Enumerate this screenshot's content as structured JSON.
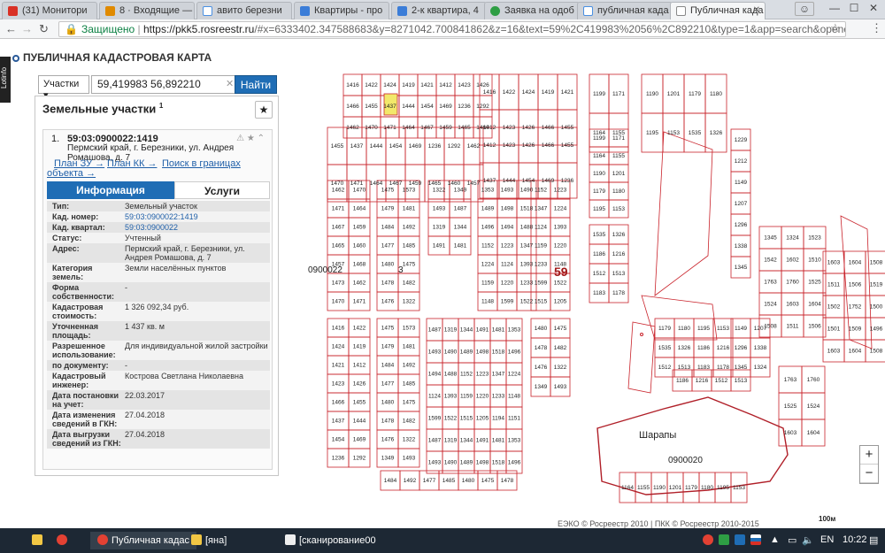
{
  "browser": {
    "tabs": [
      {
        "title": "(31) Монитори",
        "color": "#d93025"
      },
      {
        "title": "8 · Входящие —",
        "color": "#e08a00"
      },
      {
        "title": "авито березни",
        "color": "#4a90e2"
      },
      {
        "title": "Квартиры - про",
        "color": "#3b7dd8"
      },
      {
        "title": "2-к квартира, 4",
        "color": "#3b7dd8"
      },
      {
        "title": "Заявка на одоб",
        "color": "#2e9e44"
      },
      {
        "title": "публичная када",
        "color": "#4a90e2"
      },
      {
        "title": "Публичная када",
        "color": "#e9eaec"
      }
    ],
    "secure_label": "Защищено",
    "url_host": "https://pkk5.rosreestr.ru",
    "url_path": "/#x=6333402.347588683&y=8271042.700841862&z=16&text=59%2C419983%2056%2C892210&type=1&app=search&opened=1"
  },
  "app": {
    "logo_text": "Lotinfo",
    "title": "ПУБЛИЧНАЯ КАДАСТРОВАЯ КАРТА",
    "search": {
      "type_label": "Участки",
      "query": "59,419983 56,892210",
      "find_label": "Найти"
    },
    "panel": {
      "heading": "Земельные участки",
      "count": "1",
      "item_index": "1.",
      "cad_number": "59:03:0900022:1419",
      "address": "Пермский край, г. Березники, ул. Андрея Ромашова, д. 7",
      "links": {
        "plan_zu": "План ЗУ →",
        "plan_kk": "План КК →",
        "search_in": "Поиск в границах",
        "search_in2": "объекта →"
      },
      "tab_info": "Информация",
      "tab_services": "Услуги",
      "attributes": [
        {
          "k": "Тип:",
          "v": "Земельный участок"
        },
        {
          "k": "Кад. номер:",
          "v": "59:03:0900022:1419",
          "link": true
        },
        {
          "k": "Кад. квартал:",
          "v": "59:03:0900022",
          "link": true
        },
        {
          "k": "Статус:",
          "v": "Учтенный"
        },
        {
          "k": "Адрес:",
          "v": "Пермский край, г. Березники, ул. Андрея Ромашова, д. 7"
        },
        {
          "k": "Категория земель:",
          "v": "Земли населённых пунктов"
        },
        {
          "k": "Форма собственности:",
          "v": "-"
        },
        {
          "k": "Кадастровая стоимость:",
          "v": "1 326 092,34 руб."
        },
        {
          "k": "Уточненная площадь:",
          "v": "1 437 кв. м"
        },
        {
          "k": "Разрешенное использование:",
          "v": "Для индивидуальной жилой застройки"
        },
        {
          "k": "по документу:",
          "v": "-"
        },
        {
          "k": "Кадастровый инженер:",
          "v": "Кострова Светлана Николаевна"
        },
        {
          "k": "Дата постановки на учет:",
          "v": "22.03.2017"
        },
        {
          "k": "Дата изменения сведений в ГКН:",
          "v": "27.04.2018"
        },
        {
          "k": "Дата выгрузки сведений из ГКН:",
          "v": "27.04.2018"
        }
      ]
    },
    "map": {
      "quarter_labels": [
        "0900022",
        "3",
        "59",
        "0900020",
        "Шарапы"
      ],
      "parcels_col1": [
        "1416",
        "1422",
        "1424",
        "1419",
        "1421",
        "1412",
        "1423",
        "1426",
        "1466",
        "1455",
        "1437",
        "1444",
        "1454",
        "1469",
        "1236",
        "1292",
        "1462",
        "1470",
        "1471",
        "1464",
        "1467",
        "1459",
        "1465",
        "1460",
        "1457",
        "1468",
        "1473"
      ],
      "parcels_col2": [
        "1475",
        "1573",
        "1479",
        "1481",
        "1484",
        "1492",
        "1477",
        "1485",
        "1480",
        "1475",
        "1478",
        "1482",
        "1476",
        "1322",
        "1349",
        "1493",
        "1487",
        "1319",
        "1344",
        "1491",
        "1481",
        "1353",
        "1493",
        "1490",
        "1489",
        "1498",
        "1518",
        "1496",
        "1494",
        "1488",
        "1152",
        "1223",
        "1347",
        "1224",
        "1124",
        "1393",
        "1159",
        "1220",
        "1233",
        "1148",
        "1599",
        "1522",
        "1515",
        "1205",
        "1194",
        "1151"
      ],
      "parcels_right": [
        "1199",
        "1171",
        "1164",
        "1155",
        "1190",
        "1201",
        "1179",
        "1180",
        "1195",
        "1153",
        "1535",
        "1326",
        "1186",
        "1216",
        "1512",
        "1513",
        "1183",
        "1178",
        "1229",
        "1212",
        "1149",
        "1207",
        "1296",
        "1338",
        "1345",
        "1324",
        "1523",
        "1542",
        "1602",
        "1510",
        "1763",
        "1760",
        "1525",
        "1524",
        "1603",
        "1604",
        "1508",
        "1511",
        "1506",
        "1519",
        "1502",
        "1752",
        "1500",
        "1501",
        "1509",
        "1496"
      ],
      "zoom_in": "+",
      "zoom_out": "−",
      "copyright": "ЕЭКО © Росреестр 2010 | ПКК © Росреестр 2010-2015",
      "scale_label": "100м"
    }
  },
  "taskbar": {
    "items": [
      "Публичная кадас",
      "[яна]",
      "[сканирование00"
    ],
    "lang": "EN",
    "time": "10:22"
  }
}
